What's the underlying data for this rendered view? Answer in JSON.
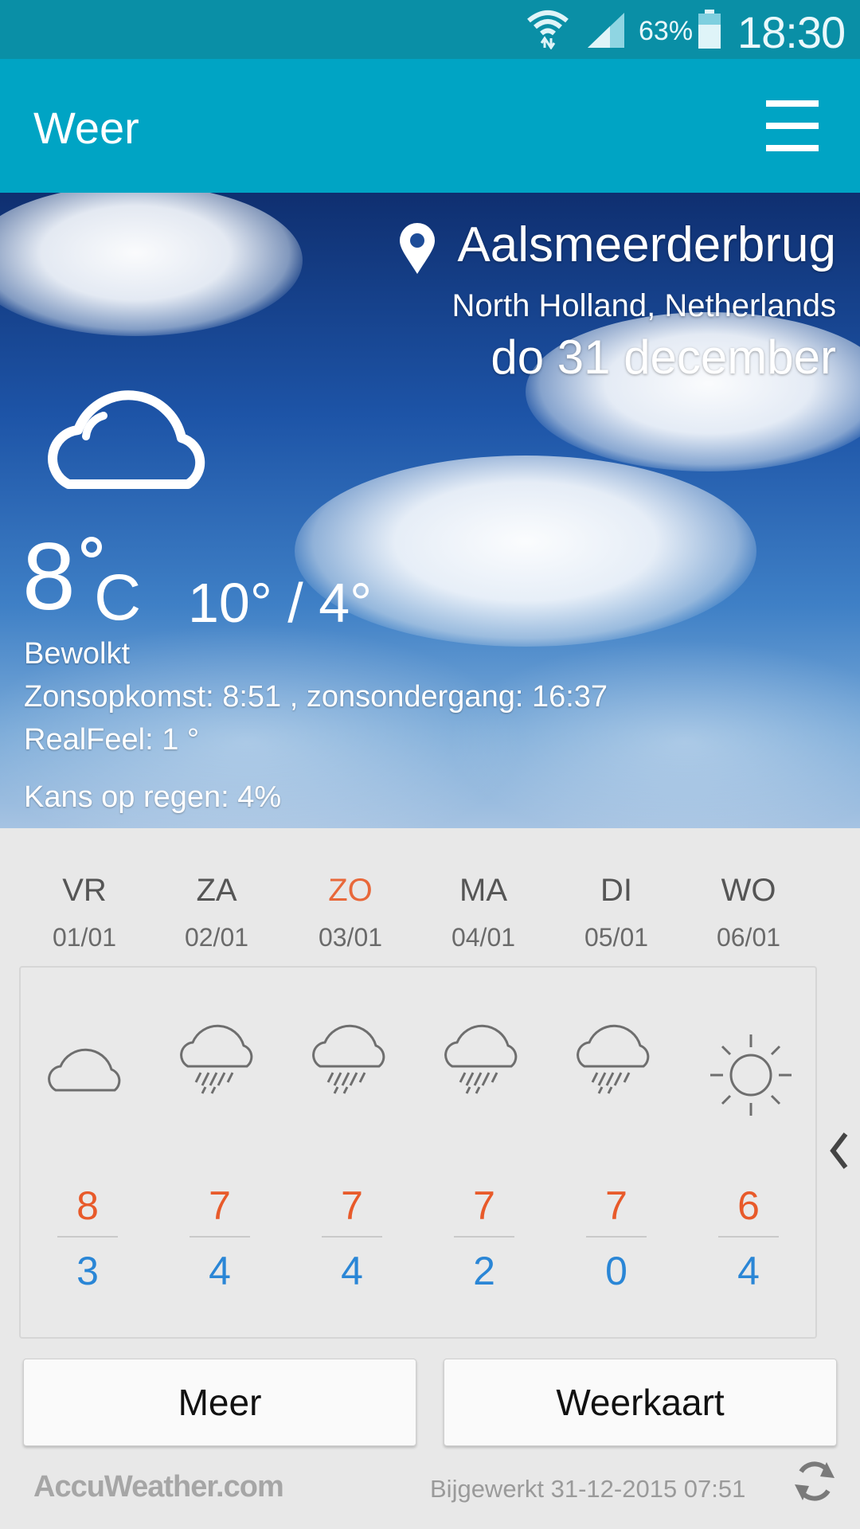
{
  "statusbar": {
    "battery": "63%",
    "time": "18:30"
  },
  "appbar": {
    "title": "Weer"
  },
  "current": {
    "city": "Aalsmeerderbrug",
    "region": "North Holland, Netherlands",
    "date": "do 31 december",
    "temp": "8",
    "unit": "C",
    "hi_lo": "10° / 4°",
    "condition": "Bewolkt",
    "sun": "Zonsopkomst: 8:51 , zonsondergang: 16:37",
    "realfeel": "RealFeel: 1 °",
    "rain": "Kans op regen: 4%",
    "icon": "cloud-icon"
  },
  "forecast": [
    {
      "day": "VR",
      "date": "01/01",
      "icon": "cloud-icon",
      "hi": "8",
      "lo": "3"
    },
    {
      "day": "ZA",
      "date": "02/01",
      "icon": "rain-icon",
      "hi": "7",
      "lo": "4"
    },
    {
      "day": "ZO",
      "date": "03/01",
      "icon": "rain-icon",
      "hi": "7",
      "lo": "4"
    },
    {
      "day": "MA",
      "date": "04/01",
      "icon": "rain-icon",
      "hi": "7",
      "lo": "2"
    },
    {
      "day": "DI",
      "date": "05/01",
      "icon": "rain-icon",
      "hi": "7",
      "lo": "0"
    },
    {
      "day": "WO",
      "date": "06/01",
      "icon": "sun-icon",
      "hi": "6",
      "lo": "4"
    }
  ],
  "buttons": {
    "more": "Meer",
    "map": "Weerkaart"
  },
  "footer": {
    "brand": "AccuWeather.com",
    "updated": "Bijgewerkt 31-12-2015 07:51"
  },
  "colors": {
    "appbar": "#00a4c4",
    "statusbar": "#0a8fa6",
    "high": "#e85a2a",
    "low": "#2a86d6",
    "sunday": "#e8683a"
  }
}
